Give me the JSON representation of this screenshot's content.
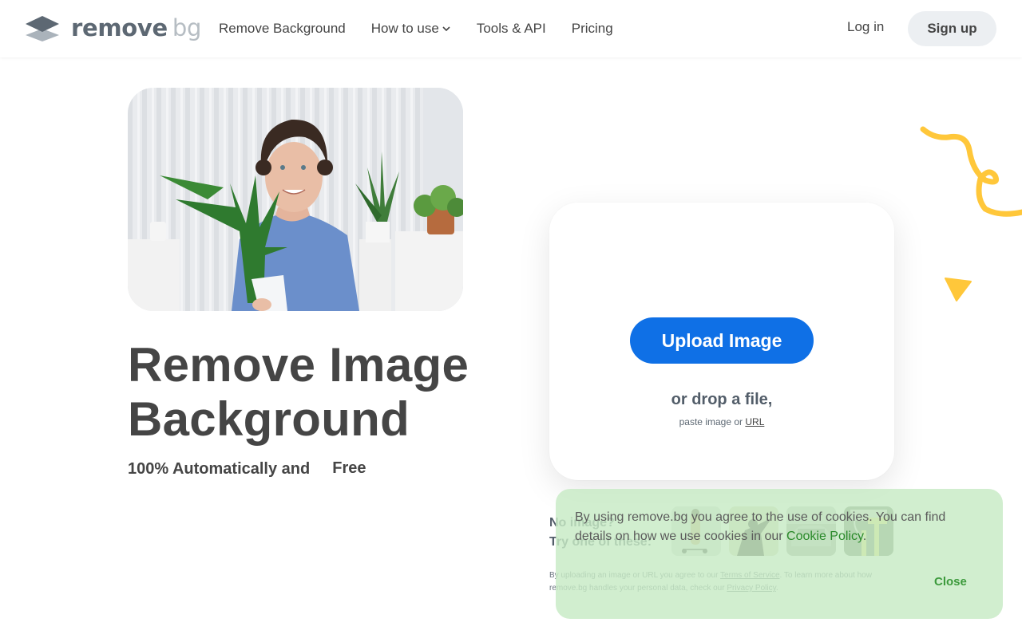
{
  "header": {
    "logo": {
      "primary": "remove",
      "secondary": "bg",
      "icon": "layers-icon"
    },
    "nav": [
      {
        "label": "Remove Background"
      },
      {
        "label": "How to use",
        "has_dropdown": true
      },
      {
        "label": "Tools & API"
      },
      {
        "label": "Pricing"
      }
    ],
    "login_label": "Log in",
    "signup_label": "Sign up"
  },
  "hero": {
    "image_alt": "Smiling man with curly hair holding a potted plant",
    "title_line1": "Remove Image",
    "title_line2": "Background",
    "subtitle": "100% Automatically and",
    "badge": "Free"
  },
  "upload": {
    "button_label": "Upload Image",
    "drop_text": "or drop a file,",
    "paste_prefix": "paste image or",
    "url_link": "URL"
  },
  "samples": {
    "line1": "No image?",
    "line2": "Try one of these:",
    "thumbnails": [
      {
        "name": "woman-with-scooter"
      },
      {
        "name": "person-with-dog"
      },
      {
        "name": "car"
      },
      {
        "name": "paint-roller"
      }
    ]
  },
  "terms": {
    "prefix": "By uploading an image or URL you agree to our",
    "terms_link": "Terms of Service",
    "middle": ". To learn more about how remove.bg handles your personal data, check our",
    "privacy_link": "Privacy Policy",
    "suffix": "."
  },
  "cookie_banner": {
    "text": "By using remove.bg you agree to the use of cookies. You can find details on how we use cookies in our",
    "link": "Cookie Policy",
    "suffix": ".",
    "close_label": "Close"
  },
  "colors": {
    "primary": "#0f70e6",
    "accent_yellow": "#ffc73a",
    "text": "#454545",
    "cookie_bg": "#d0ecce",
    "cookie_link": "#2a8a2a"
  }
}
